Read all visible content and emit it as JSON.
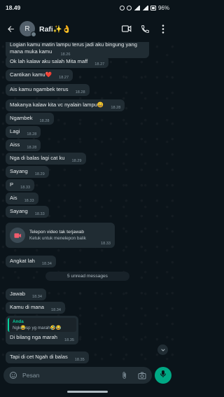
{
  "status_bar": {
    "time": "18.49",
    "battery": "96%"
  },
  "header": {
    "avatar_initial": "R",
    "contact_name": "Rafi✨👌"
  },
  "messages": [
    {
      "text": "Logian kamu matin lampu terus jadi aku bingung yang mana muka kamu",
      "time": "18.26"
    },
    {
      "text": "Ok lah kalaw aku salah Mita maff",
      "time": "18.27"
    },
    {
      "text": "Cantikan kamu❤️",
      "time": "18.27"
    },
    {
      "text": "Ais kamu ngambek terus",
      "time": "18.28"
    },
    {
      "text": "Makanya kalaw kita vc nyalain lampu😄",
      "time": "18.28"
    },
    {
      "text": "Ngambek",
      "time": "18.28"
    },
    {
      "text": "Lagi",
      "time": "18.28"
    },
    {
      "text": "Aiss",
      "time": "18.28"
    },
    {
      "text": "Nga di balas lagi cat ku",
      "time": "18.29"
    },
    {
      "text": "Sayang",
      "time": "18.29"
    },
    {
      "text": "P",
      "time": "18.33"
    },
    {
      "text": "Ais",
      "time": "18.33"
    },
    {
      "text": "Sayang",
      "time": "18.33"
    },
    {
      "text": "Angkat lah",
      "time": "18.34"
    },
    {
      "text": "Jawab",
      "time": "18.34"
    },
    {
      "text": "Kamu di mana",
      "time": "18.34"
    },
    {
      "text": "Di bilang nga marah",
      "time": "18.35"
    },
    {
      "text": "Tapi di cet Ngah di balas",
      "time": "18.35"
    }
  ],
  "call": {
    "title": "Telepon video tak terjawab",
    "subtitle": "Ketuk untuk menelepon balik",
    "time": "18.33"
  },
  "unread": "5 unread messages",
  "reply": {
    "author": "Anda",
    "quoted": "Ngk😂sp yg marah🤣😂"
  },
  "composer": {
    "placeholder": "Pesan"
  },
  "colors": {
    "accent": "#00a884",
    "bubble": "#202c33",
    "background": "#0b141a",
    "quote_bar": "#06cf9c",
    "call_icon": "#f15c6d"
  },
  "icons": [
    "back-arrow-icon",
    "video-call-icon",
    "phone-icon",
    "more-vert-icon",
    "missed-video-call-icon",
    "chevron-down-icon",
    "sticker-icon",
    "attach-icon",
    "camera-icon",
    "mic-icon"
  ]
}
